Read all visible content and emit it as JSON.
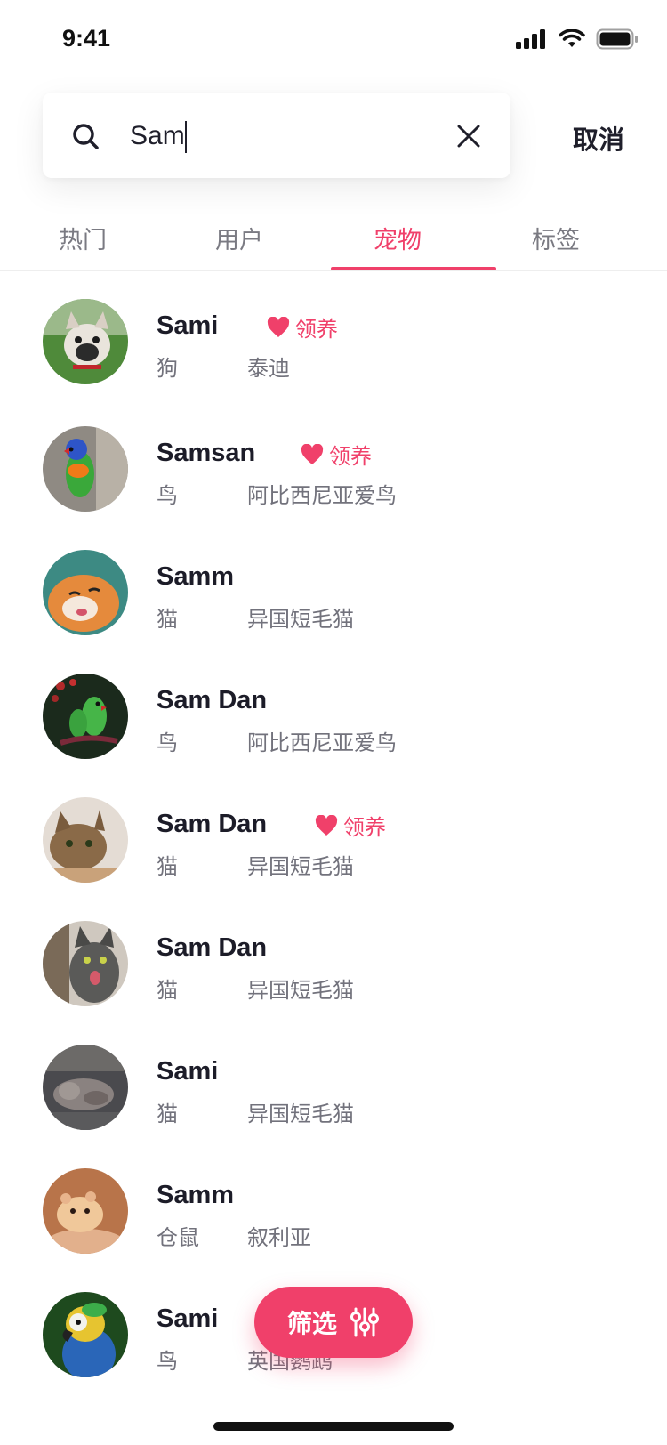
{
  "status_bar": {
    "time": "9:41"
  },
  "search": {
    "value": "Sam",
    "cancel_label": "取消"
  },
  "tabs": [
    {
      "label": "热门",
      "active": false
    },
    {
      "label": "用户",
      "active": false
    },
    {
      "label": "宠物",
      "active": true
    },
    {
      "label": "标签",
      "active": false
    }
  ],
  "adopt_label": "领养",
  "results": [
    {
      "name": "Sami",
      "adopt": true,
      "species": "狗",
      "breed": "泰迪"
    },
    {
      "name": "Samsan",
      "adopt": true,
      "species": "鸟",
      "breed": "阿比西尼亚爱鸟"
    },
    {
      "name": "Samm",
      "adopt": false,
      "species": "猫",
      "breed": "异国短毛猫"
    },
    {
      "name": "Sam Dan",
      "adopt": false,
      "species": "鸟",
      "breed": "阿比西尼亚爱鸟"
    },
    {
      "name": "Sam Dan",
      "adopt": true,
      "species": "猫",
      "breed": "异国短毛猫"
    },
    {
      "name": "Sam Dan",
      "adopt": false,
      "species": "猫",
      "breed": "异国短毛猫"
    },
    {
      "name": "Sami",
      "adopt": false,
      "species": "猫",
      "breed": "异国短毛猫"
    },
    {
      "name": "Samm",
      "adopt": false,
      "species": "仓鼠",
      "breed": "叙利亚"
    },
    {
      "name": "Sami",
      "adopt": false,
      "species": "鸟",
      "breed": "英国鹦鹉"
    }
  ],
  "filter": {
    "label": "筛选"
  },
  "colors": {
    "accent": "#f0406a",
    "text": "#1f1f2b",
    "muted": "#72727c"
  }
}
